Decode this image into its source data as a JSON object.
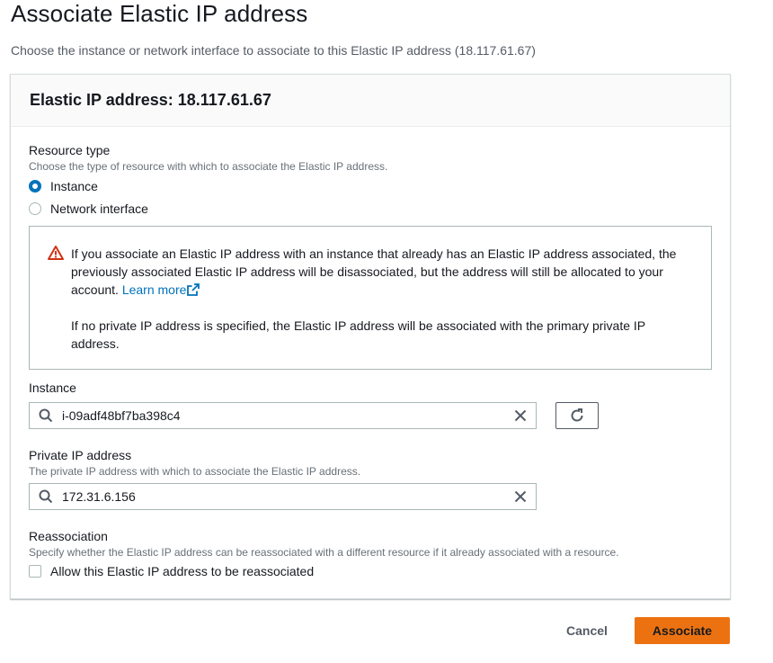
{
  "page": {
    "title": "Associate Elastic IP address",
    "description": "Choose the instance or network interface to associate to this Elastic IP address (18.117.61.67)"
  },
  "panel": {
    "header": "Elastic IP address: 18.117.61.67",
    "resource_type": {
      "label": "Resource type",
      "description": "Choose the type of resource with which to associate the Elastic IP address.",
      "options": [
        {
          "label": "Instance",
          "selected": true
        },
        {
          "label": "Network interface",
          "selected": false
        }
      ]
    },
    "alert": {
      "text": "If you associate an Elastic IP address with an instance that already has an Elastic IP address associated, the previously associated Elastic IP address will be disassociated, but the address will still be allocated to your account.",
      "link": "Learn more",
      "text2": "If no private IP address is specified, the Elastic IP address will be associated with the primary private IP address."
    },
    "instance": {
      "label": "Instance",
      "value": "i-09adf48bf7ba398c4"
    },
    "private_ip": {
      "label": "Private IP address",
      "description": "The private IP address with which to associate the Elastic IP address.",
      "value": "172.31.6.156"
    },
    "reassociation": {
      "label": "Reassociation",
      "description": "Specify whether the Elastic IP address can be reassociated with a different resource if it already associated with a resource.",
      "checkbox_label": "Allow this Elastic IP address to be reassociated",
      "checked": false
    }
  },
  "footer": {
    "cancel": "Cancel",
    "associate": "Associate"
  },
  "colors": {
    "primary": "#ec7211",
    "link": "#0073bb",
    "warning": "#d13212"
  }
}
